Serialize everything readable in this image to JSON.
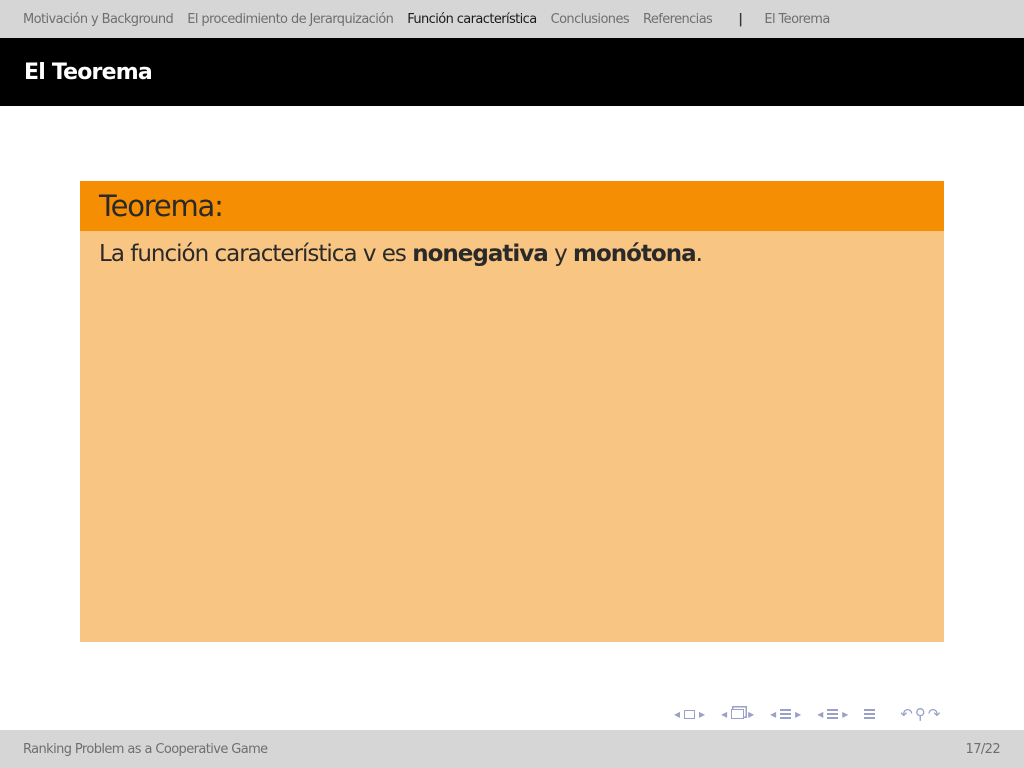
{
  "nav": {
    "sections": [
      {
        "label": "Motivación y Background",
        "active": false
      },
      {
        "label": "El procedimiento de Jerarquización",
        "active": false
      },
      {
        "label": "Función característica",
        "active": true
      },
      {
        "label": "Conclusiones",
        "active": false
      },
      {
        "label": "Referencias",
        "active": false
      }
    ],
    "separator": "|",
    "subsection": "El Teorema"
  },
  "frame": {
    "title": "El Teorema"
  },
  "theorem": {
    "heading": "Teorema:",
    "text_before": "La función característica v es ",
    "bold1": "nonegativa",
    "text_mid": " y ",
    "bold2": "monótona",
    "text_end": "."
  },
  "colors": {
    "nav_bg": "#d6d6d6",
    "title_bg": "#000000",
    "block_header": "#f68e03",
    "block_body": "#f8c582",
    "nav_symbols": "#9aa0c8"
  },
  "footer": {
    "left": "Ranking Problem as a Cooperative Game",
    "right": "17/22"
  },
  "nav_icons": [
    "arrow-left-icon",
    "frame-icon",
    "arrow-right-icon",
    "subsection-icon",
    "section-icon",
    "appendix-icon",
    "search-icon",
    "loop-back-icon",
    "loop-forward-icon"
  ]
}
